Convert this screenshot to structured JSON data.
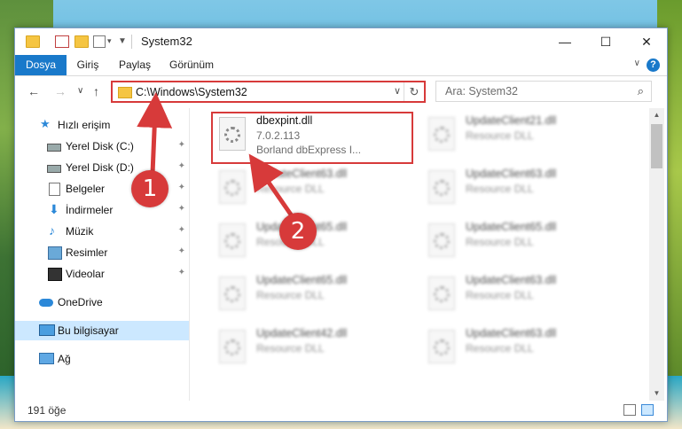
{
  "window": {
    "title": "System32"
  },
  "window_controls": {
    "minimize": "—",
    "maximize": "☐",
    "close": "✕"
  },
  "ribbon": {
    "tabs": [
      {
        "label": "Dosya",
        "active": true
      },
      {
        "label": "Giriş"
      },
      {
        "label": "Paylaş"
      },
      {
        "label": "Görünüm"
      }
    ],
    "help_label": "?",
    "expand_label": "∨"
  },
  "nav": {
    "back": "←",
    "forward": "→",
    "recent": "∨",
    "up": "↑",
    "address": "C:\\Windows\\System32",
    "address_dropdown": "∨",
    "refresh": "↻",
    "search_placeholder": "Ara: System32",
    "search_icon": "⌕"
  },
  "sidebar": {
    "items": [
      {
        "label": "Hızlı erişim",
        "icon": "star-icon"
      },
      {
        "label": "Yerel Disk (C:)",
        "icon": "drive-icon",
        "pinned": true
      },
      {
        "label": "Yerel Disk (D:)",
        "icon": "drive-icon",
        "pinned": true
      },
      {
        "label": "Belgeler",
        "icon": "documents-icon",
        "pinned": true
      },
      {
        "label": "İndirmeler",
        "icon": "downloads-icon",
        "pinned": true
      },
      {
        "label": "Müzik",
        "icon": "music-icon",
        "pinned": true
      },
      {
        "label": "Resimler",
        "icon": "pictures-icon",
        "pinned": true
      },
      {
        "label": "Videolar",
        "icon": "videos-icon",
        "pinned": true
      },
      {
        "label": "OneDrive",
        "icon": "onedrive-icon"
      },
      {
        "label": "Bu bilgisayar",
        "icon": "computer-icon",
        "selected": true
      },
      {
        "label": "Ağ",
        "icon": "network-icon"
      }
    ],
    "pin_glyph": "✦"
  },
  "files": [
    {
      "name": "dbexpint.dll",
      "line2": "7.0.2.113",
      "line3": "Borland dbExpress I...",
      "highlighted": true
    },
    {
      "name": "UpdateClient21.dll",
      "line2": "Resource DLL"
    },
    {
      "name": "UpdateClient63.dll",
      "line2": "Resource DLL"
    },
    {
      "name": "UpdateClient63.dll",
      "line2": "Resource DLL"
    },
    {
      "name": "UpdateClient65.dll",
      "line2": "Resource DLL"
    },
    {
      "name": "UpdateClient65.dll",
      "line2": "Resource DLL"
    },
    {
      "name": "UpdateClient65.dll",
      "line2": "Resource DLL"
    },
    {
      "name": "UpdateClient63.dll",
      "line2": "Resource DLL"
    },
    {
      "name": "UpdateClient42.dll",
      "line2": "Resource DLL"
    },
    {
      "name": "UpdateClient63.dll",
      "line2": "Resource DLL"
    }
  ],
  "status": {
    "item_count": "191 öğe"
  },
  "annotations": {
    "callout_1": "1",
    "callout_2": "2",
    "color": "#d73a3a"
  }
}
